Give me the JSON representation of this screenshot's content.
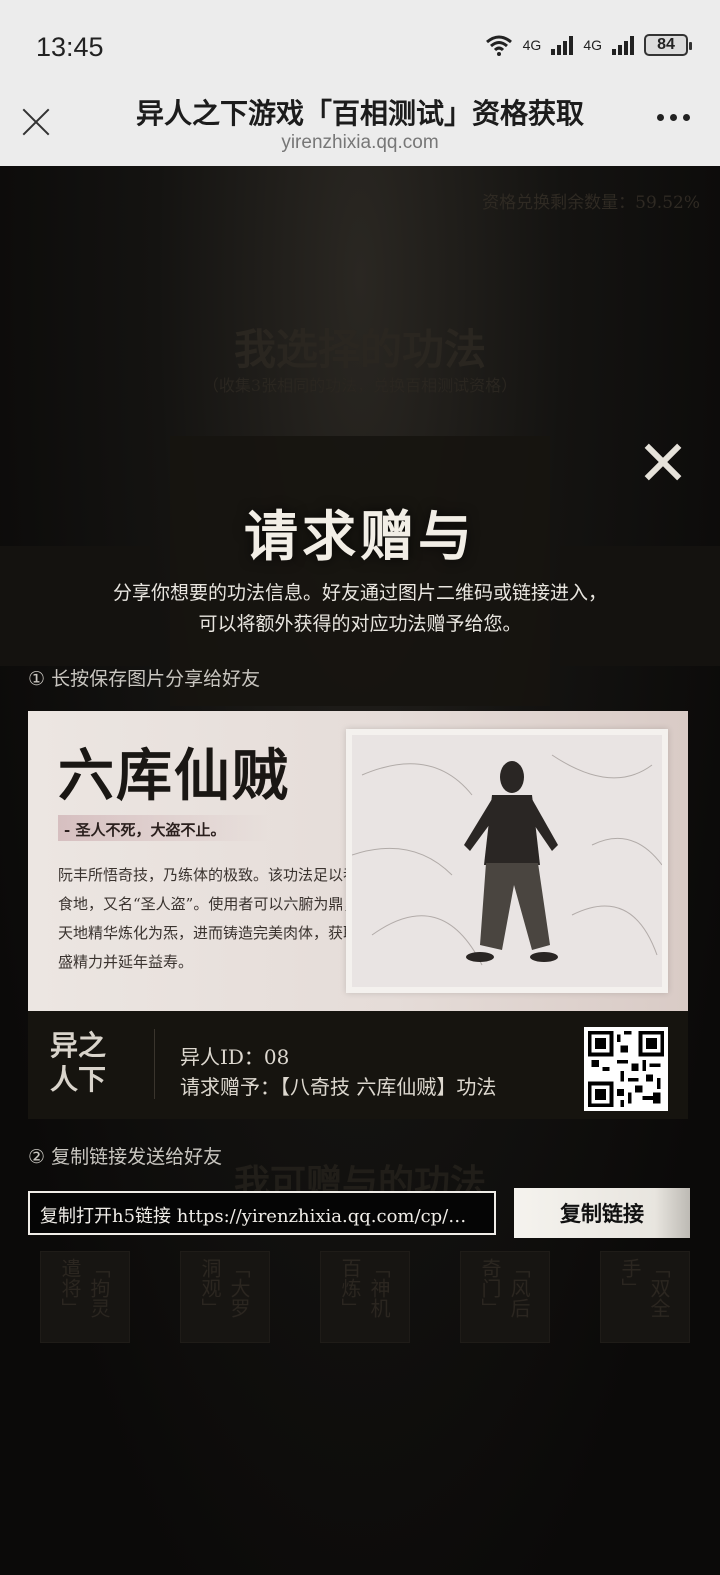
{
  "status": {
    "time": "13:45",
    "network1": "4G",
    "network2": "4G",
    "battery": "84"
  },
  "titlebar": {
    "title": "异人之下游戏「百相测试」资格获取",
    "url": "yirenzhixia.qq.com"
  },
  "background": {
    "remain_text": "资格兑换剩余数量：59.52%",
    "section_title": "我选择的功法",
    "section_note": "（收集3张相同的功法，兑换百相测试资格）",
    "giftable_title": "我可赠与的功法",
    "giftable_items": [
      "「拘灵遣将」",
      "「大罗洞观」",
      "「神机百炼」",
      "「风后奇门」",
      "「双全手」"
    ]
  },
  "modal": {
    "title": "请求赠与",
    "desc_line1": "分享你想要的功法信息。好友通过图片二维码或链接进入，",
    "desc_line2": "可以将额外获得的对应功法赠予给您。",
    "step1": "① 长按保存图片分享给好友",
    "step2": "② 复制链接发送给好友",
    "card": {
      "name": "六库仙贼",
      "motto": "- 圣人不死，大盗不止。",
      "text": "阮丰所悟奇技，乃练体的极致。该功法足以吞天食地，又名“圣人盗”。使用者可以六腑为鼎，纳天地精华炼化为炁，进而铸造完美肉体，获取旺盛精力并延年益寿。"
    },
    "footer": {
      "logo_top": "异之",
      "logo_bottom": "人下",
      "id_label": "异人ID：08",
      "request": "请求赠予：【八奇技 六库仙贼】功法"
    },
    "link_text": "复制打开h5链接 https://yirenzhixia.qq.com/cp/…",
    "copy_button": "复制链接"
  }
}
